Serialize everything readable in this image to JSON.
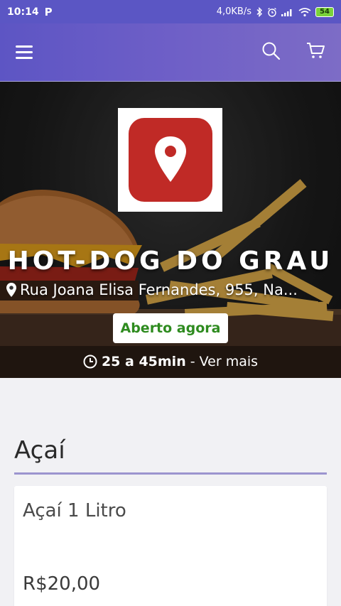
{
  "status_bar": {
    "time": "10:14",
    "app_indicator": "P",
    "network_speed": "4,0KB/s",
    "battery": "54"
  },
  "app_bar": {
    "menu_icon": "hamburger-menu-icon",
    "search_icon": "search-icon",
    "cart_icon": "cart-icon"
  },
  "store": {
    "name": "HOT-DOG DO GRAU",
    "address": "Rua Joana Elisa Fernandes, 955, Na...",
    "status": "Aberto agora",
    "delivery_time": "25 a 45min",
    "see_more": "- Ver mais"
  },
  "menu": {
    "section_title": "Açaí",
    "products": [
      {
        "name": "Açaí 1 Litro",
        "price": "R$20,00"
      }
    ]
  },
  "colors": {
    "header": "#5d55c4",
    "accent": "#9c94cf",
    "logo": "#c02a26",
    "open_status": "#2e8b1f"
  }
}
